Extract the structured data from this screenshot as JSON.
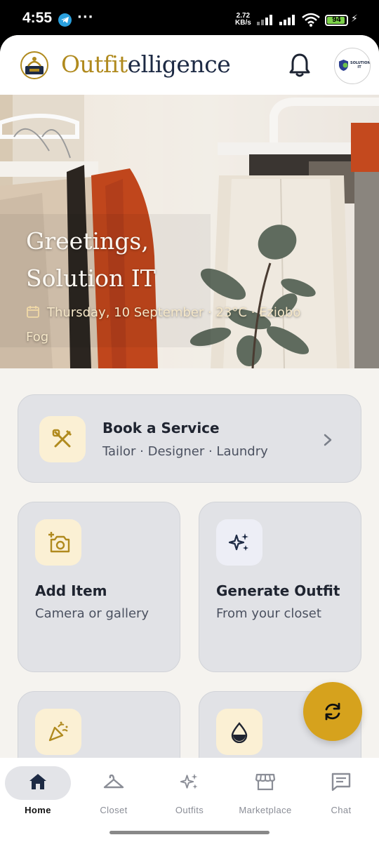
{
  "status_bar": {
    "time": "4:55",
    "overflow": "···",
    "speed_value": "2.72",
    "speed_unit": "KB/s",
    "battery": "94",
    "battery_level": 0.94,
    "icons": [
      "telegram-icon",
      "signal-icon",
      "wifi-icon",
      "battery-icon",
      "charging-icon"
    ]
  },
  "header": {
    "title_part1": "Outfit",
    "title_part2": "elligence",
    "avatar_text": "SOLUTION IT",
    "colors": {
      "brand_gold": "#b08a1e",
      "brand_navy": "#1d2a44"
    }
  },
  "hero": {
    "greeting_line1": "Greetings,",
    "greeting_line2": "Solution IT",
    "weather_line1": "Thursday, 10 September · 23°C · Eziobo",
    "weather_line2": "Fog"
  },
  "cards": {
    "book_service": {
      "title": "Book a Service",
      "subtitle": "Tailor · Designer · Laundry",
      "icon": "tools-icon"
    },
    "add_item": {
      "title": "Add Item",
      "subtitle": "Camera or gallery",
      "icon": "camera-add-icon"
    },
    "generate_outfit": {
      "title": "Generate Outfit",
      "subtitle": "From your closet",
      "icon": "sparkles-icon"
    },
    "party_icon": "party-popper-icon",
    "drop_icon": "drop-icon"
  },
  "fab": {
    "icon": "sync-icon",
    "color": "#d6a21d"
  },
  "nav": {
    "items": [
      {
        "label": "Home",
        "icon": "home-icon",
        "active": true
      },
      {
        "label": "Closet",
        "icon": "hanger-icon",
        "active": false
      },
      {
        "label": "Outfits",
        "icon": "sparkles-icon",
        "active": false
      },
      {
        "label": "Marketplace",
        "icon": "store-icon",
        "active": false
      },
      {
        "label": "Chat",
        "icon": "chat-icon",
        "active": false
      }
    ]
  }
}
